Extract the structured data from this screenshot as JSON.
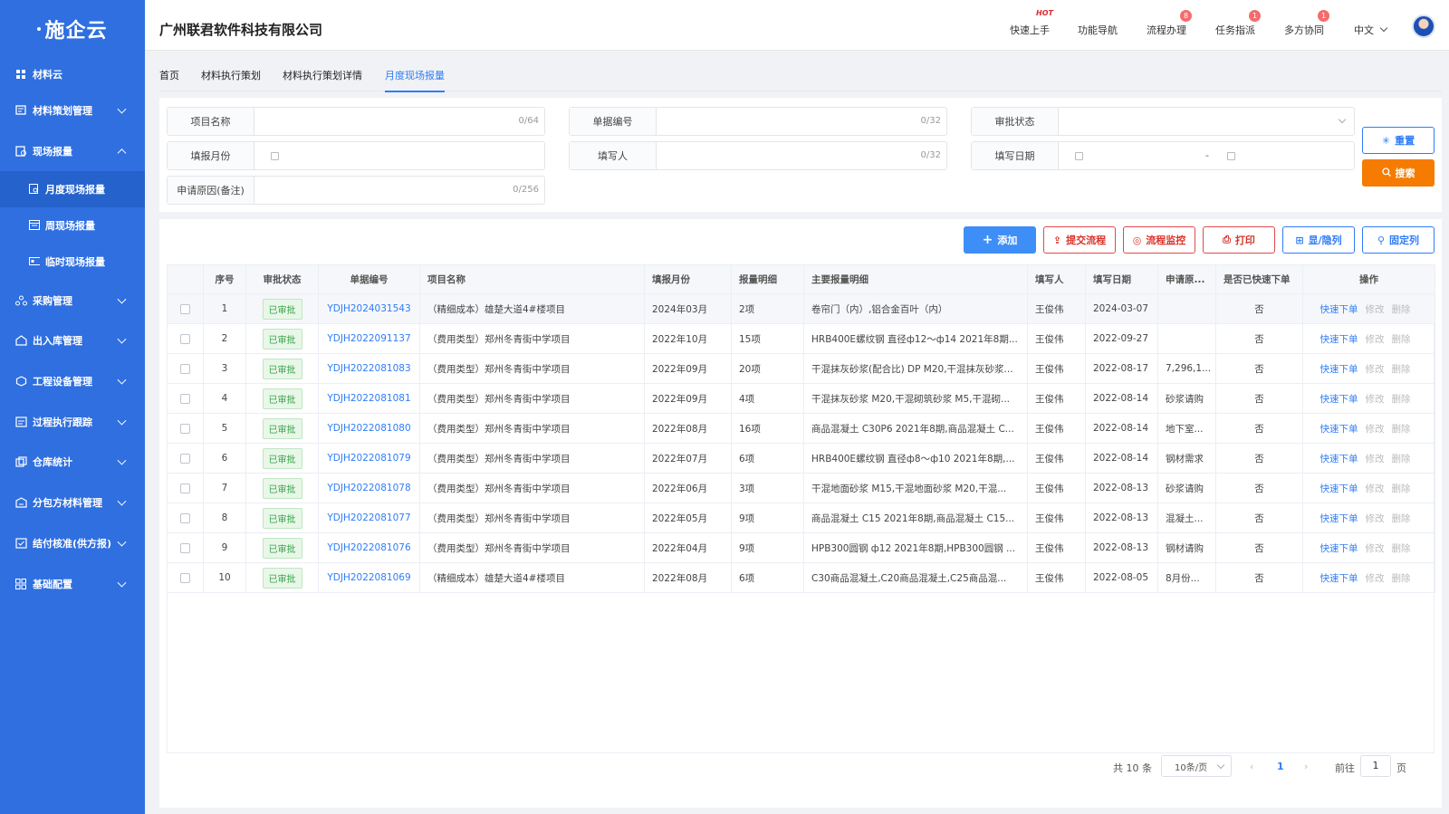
{
  "sidebar": {
    "logo": "施企云",
    "items": [
      {
        "label": "材料云",
        "icon": "grid-icon"
      },
      {
        "label": "材料策划管理",
        "icon": "plan-icon"
      },
      {
        "label": "现场报量",
        "icon": "report-icon"
      },
      {
        "label": "采购管理",
        "icon": "purchase-icon"
      },
      {
        "label": "出入库管理",
        "icon": "warehouse-icon"
      },
      {
        "label": "工程设备管理",
        "icon": "equipment-icon"
      },
      {
        "label": "过程执行跟踪",
        "icon": "track-icon"
      },
      {
        "label": "仓库统计",
        "icon": "stats-icon"
      },
      {
        "label": "分包方材料管理",
        "icon": "subcontract-icon"
      },
      {
        "label": "结付核准(供方报)",
        "icon": "settlement-icon"
      },
      {
        "label": "基础配置",
        "icon": "config-icon"
      }
    ],
    "sub_items": [
      {
        "label": "月度现场报量",
        "active": true
      },
      {
        "label": "周现场报量",
        "active": false
      },
      {
        "label": "临时现场报量",
        "active": false
      }
    ]
  },
  "header": {
    "company": "广州联君软件科技有限公司",
    "nav": [
      {
        "label": "快速上手",
        "badge": "HOT"
      },
      {
        "label": "功能导航",
        "badge": ""
      },
      {
        "label": "流程办理",
        "badge": "8"
      },
      {
        "label": "任务指派",
        "badge": "1"
      },
      {
        "label": "多方协同",
        "badge": "1"
      }
    ],
    "language": "中文"
  },
  "breadcrumb": [
    "首页",
    "材料执行策划",
    "材料执行策划详情",
    "月度现场报量"
  ],
  "filters": {
    "project_name": {
      "label": "项目名称",
      "count": "0/64"
    },
    "doc_no": {
      "label": "单据编号",
      "count": "0/32"
    },
    "approval_status": {
      "label": "审批状态"
    },
    "report_month": {
      "label": "填报月份"
    },
    "filler": {
      "label": "填写人",
      "count": "0/32"
    },
    "fill_date": {
      "label": "填写日期",
      "separator": "-"
    },
    "reason": {
      "label": "申请原因(备注)",
      "count": "0/256"
    },
    "reset_label": "重置",
    "search_label": "搜索"
  },
  "toolbar": {
    "add": "添加",
    "submit": "提交流程",
    "monitor": "流程监控",
    "print": "打印",
    "columns": "显/隐列",
    "fix": "固定列"
  },
  "table": {
    "headers": [
      "序号",
      "审批状态",
      "单据编号",
      "项目名称",
      "填报月份",
      "报量明细",
      "主要报量明细",
      "填写人",
      "填写日期",
      "申请原...",
      "是否已快速下单",
      "操作"
    ],
    "ops": {
      "quick": "快速下单",
      "edit": "修改",
      "delete": "删除"
    },
    "rows": [
      {
        "no": "1",
        "status": "已审批",
        "code": "YDJH2024031543",
        "project": "（精细成本）雄楚大道4#楼项目",
        "month": "2024年03月",
        "detail": "2项",
        "main": "卷帘门（内）,铝合金百叶（内）",
        "filler": "王俊伟",
        "date": "2024-03-07",
        "reason": "",
        "quick": "否"
      },
      {
        "no": "2",
        "status": "已审批",
        "code": "YDJH2022091137",
        "project": "（费用类型）郑州冬青街中学项目",
        "month": "2022年10月",
        "detail": "15项",
        "main": "HRB400E螺纹钢 直径ф12～ф14 2021年8期...",
        "filler": "王俊伟",
        "date": "2022-09-27",
        "reason": "",
        "quick": "否"
      },
      {
        "no": "3",
        "status": "已审批",
        "code": "YDJH2022081083",
        "project": "（费用类型）郑州冬青街中学项目",
        "month": "2022年09月",
        "detail": "20项",
        "main": "干混抹灰砂浆(配合比) DP M20,干混抹灰砂浆...",
        "filler": "王俊伟",
        "date": "2022-08-17",
        "reason": "7,296,1...",
        "quick": "否"
      },
      {
        "no": "4",
        "status": "已审批",
        "code": "YDJH2022081081",
        "project": "（费用类型）郑州冬青街中学项目",
        "month": "2022年09月",
        "detail": "4项",
        "main": "干混抹灰砂浆 M20,干混砌筑砂浆 M5,干混砌...",
        "filler": "王俊伟",
        "date": "2022-08-14",
        "reason": "砂浆请购",
        "quick": "否"
      },
      {
        "no": "5",
        "status": "已审批",
        "code": "YDJH2022081080",
        "project": "（费用类型）郑州冬青街中学项目",
        "month": "2022年08月",
        "detail": "16项",
        "main": "商品混凝土 C30P6 2021年8期,商品混凝土 C...",
        "filler": "王俊伟",
        "date": "2022-08-14",
        "reason": "地下室...",
        "quick": "否"
      },
      {
        "no": "6",
        "status": "已审批",
        "code": "YDJH2022081079",
        "project": "（费用类型）郑州冬青街中学项目",
        "month": "2022年07月",
        "detail": "6项",
        "main": "HRB400E螺纹钢 直径ф8～ф10 2021年8期,...",
        "filler": "王俊伟",
        "date": "2022-08-14",
        "reason": "钢材需求",
        "quick": "否"
      },
      {
        "no": "7",
        "status": "已审批",
        "code": "YDJH2022081078",
        "project": "（费用类型）郑州冬青街中学项目",
        "month": "2022年06月",
        "detail": "3项",
        "main": "干混地面砂浆 M15,干混地面砂浆 M20,干混...",
        "filler": "王俊伟",
        "date": "2022-08-13",
        "reason": "砂浆请购",
        "quick": "否"
      },
      {
        "no": "8",
        "status": "已审批",
        "code": "YDJH2022081077",
        "project": "（费用类型）郑州冬青街中学项目",
        "month": "2022年05月",
        "detail": "9项",
        "main": "商品混凝土 C15 2021年8期,商品混凝土 C15...",
        "filler": "王俊伟",
        "date": "2022-08-13",
        "reason": "混凝土...",
        "quick": "否"
      },
      {
        "no": "9",
        "status": "已审批",
        "code": "YDJH2022081076",
        "project": "（费用类型）郑州冬青街中学项目",
        "month": "2022年04月",
        "detail": "9项",
        "main": "HPB300圆钢 ф12 2021年8期,HPB300圆钢 ...",
        "filler": "王俊伟",
        "date": "2022-08-13",
        "reason": "钢材请购",
        "quick": "否"
      },
      {
        "no": "10",
        "status": "已审批",
        "code": "YDJH2022081069",
        "project": "（精细成本）雄楚大道4#楼项目",
        "month": "2022年08月",
        "detail": "6项",
        "main": "C30商品混凝土,C20商品混凝土,C25商品混...",
        "filler": "王俊伟",
        "date": "2022-08-05",
        "reason": "8月份...",
        "quick": "否"
      }
    ]
  },
  "pagination": {
    "total": "共 10 条",
    "page_size": "10条/页",
    "current": "1",
    "goto_prefix": "前往",
    "goto_value": "1",
    "goto_suffix": "页"
  },
  "colors": {
    "sidebar": "#2f6fe0",
    "primary": "#2f7df6",
    "search": "#f57c00",
    "status_green": "#3aa24c"
  }
}
